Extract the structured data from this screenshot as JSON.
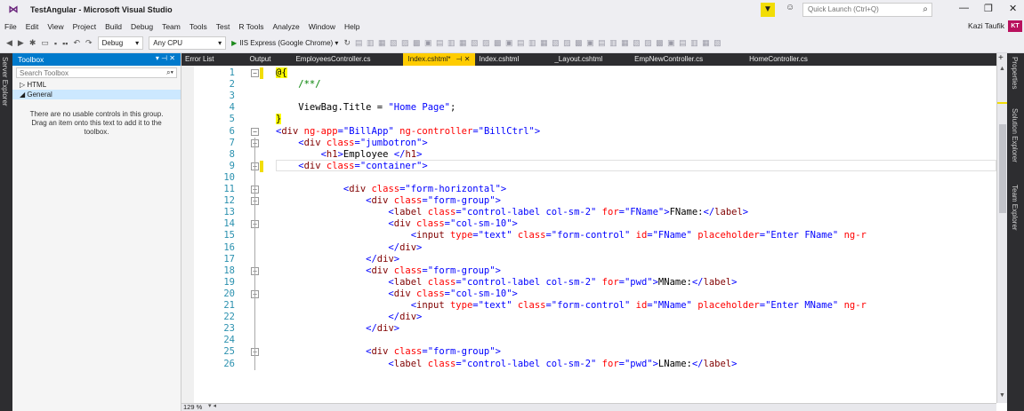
{
  "window": {
    "title": "TestAngular - Microsoft Visual Studio",
    "logo": "vs-logo",
    "quick_launch_placeholder": "Quick Launch (Ctrl+Q)"
  },
  "menu": [
    "File",
    "Edit",
    "View",
    "Project",
    "Build",
    "Debug",
    "Team",
    "Tools",
    "Test",
    "R Tools",
    "Analyze",
    "Window",
    "Help"
  ],
  "user": {
    "name": "Kazi Taufik",
    "initials": "KT",
    "badge_color": "#b9115e"
  },
  "toolbar": {
    "config": "Debug",
    "platform": "Any CPU",
    "run_target": "IIS Express (Google Chrome)"
  },
  "left_strip": {
    "label": "Server Explorer"
  },
  "toolbox": {
    "title": "Toolbox",
    "search_placeholder": "Search Toolbox",
    "groups": [
      {
        "label": "HTML",
        "expanded": false
      },
      {
        "label": "General",
        "expanded": true
      }
    ],
    "empty_message": "There are no usable controls in this group. Drag an item onto this text to add it to the toolbox."
  },
  "tabs": [
    {
      "label": "Error List"
    },
    {
      "label": "Output"
    },
    {
      "label": "EmployeesController.cs"
    },
    {
      "label": "Index.cshtml*",
      "active": true
    },
    {
      "label": "Index.cshtml"
    },
    {
      "label": "_Layout.cshtml"
    },
    {
      "label": "EmpNewController.cs"
    },
    {
      "label": "HomeController.cs"
    }
  ],
  "right_strip": [
    "Properties",
    "Solution Explorer",
    "Team Explorer"
  ],
  "editor": {
    "zoom": "129 %",
    "lines": [
      {
        "n": "1",
        "code": [
          {
            "t": "@{",
            "c": "razor"
          }
        ]
      },
      {
        "n": "2",
        "code": [
          {
            "t": "    /**/",
            "c": "cmt"
          }
        ]
      },
      {
        "n": "3",
        "code": []
      },
      {
        "n": "4",
        "code": [
          {
            "t": "    ViewBag.Title = ",
            "c": "txt"
          },
          {
            "t": "\"Home Page\"",
            "c": "str"
          },
          {
            "t": ";",
            "c": "txt"
          }
        ]
      },
      {
        "n": "5",
        "code": [
          {
            "t": "}",
            "c": "razor"
          }
        ]
      },
      {
        "n": "6",
        "code": [
          {
            "t": "<",
            "c": "punc"
          },
          {
            "t": "div",
            "c": "tag"
          },
          {
            "t": " ng-app",
            "c": "attr"
          },
          {
            "t": "=",
            "c": "punc"
          },
          {
            "t": "\"BillApp\"",
            "c": "str"
          },
          {
            "t": " ng-controller",
            "c": "attr"
          },
          {
            "t": "=",
            "c": "punc"
          },
          {
            "t": "\"BillCtrl\"",
            "c": "str"
          },
          {
            "t": ">",
            "c": "punc"
          }
        ]
      },
      {
        "n": "7",
        "code": [
          {
            "t": "    <",
            "c": "punc"
          },
          {
            "t": "div",
            "c": "tag"
          },
          {
            "t": " class",
            "c": "attr"
          },
          {
            "t": "=",
            "c": "punc"
          },
          {
            "t": "\"jumbotron\"",
            "c": "str"
          },
          {
            "t": ">",
            "c": "punc"
          }
        ]
      },
      {
        "n": "8",
        "code": [
          {
            "t": "        <",
            "c": "punc"
          },
          {
            "t": "h1",
            "c": "tag"
          },
          {
            "t": ">",
            "c": "punc"
          },
          {
            "t": "Employee ",
            "c": "txt"
          },
          {
            "t": "</",
            "c": "punc"
          },
          {
            "t": "h1",
            "c": "tag"
          },
          {
            "t": ">",
            "c": "punc"
          }
        ]
      },
      {
        "n": "9",
        "code": [
          {
            "t": "    <",
            "c": "punc"
          },
          {
            "t": "div",
            "c": "tag"
          },
          {
            "t": " class",
            "c": "attr"
          },
          {
            "t": "=",
            "c": "punc"
          },
          {
            "t": "\"container\"",
            "c": "str"
          },
          {
            "t": ">",
            "c": "punc"
          }
        ]
      },
      {
        "n": "10",
        "code": []
      },
      {
        "n": "11",
        "code": [
          {
            "t": "            <",
            "c": "punc"
          },
          {
            "t": "div",
            "c": "tag"
          },
          {
            "t": " class",
            "c": "attr"
          },
          {
            "t": "=",
            "c": "punc"
          },
          {
            "t": "\"form-horizontal\"",
            "c": "str"
          },
          {
            "t": ">",
            "c": "punc"
          }
        ]
      },
      {
        "n": "12",
        "code": [
          {
            "t": "                <",
            "c": "punc"
          },
          {
            "t": "div",
            "c": "tag"
          },
          {
            "t": " class",
            "c": "attr"
          },
          {
            "t": "=",
            "c": "punc"
          },
          {
            "t": "\"form-group\"",
            "c": "str"
          },
          {
            "t": ">",
            "c": "punc"
          }
        ]
      },
      {
        "n": "13",
        "code": [
          {
            "t": "                    <",
            "c": "punc"
          },
          {
            "t": "label",
            "c": "tag"
          },
          {
            "t": " class",
            "c": "attr"
          },
          {
            "t": "=",
            "c": "punc"
          },
          {
            "t": "\"control-label col-sm-2\"",
            "c": "str"
          },
          {
            "t": " for",
            "c": "attr"
          },
          {
            "t": "=",
            "c": "punc"
          },
          {
            "t": "\"FName\"",
            "c": "str"
          },
          {
            "t": ">",
            "c": "punc"
          },
          {
            "t": "FName:",
            "c": "txt"
          },
          {
            "t": "</",
            "c": "punc"
          },
          {
            "t": "label",
            "c": "tag"
          },
          {
            "t": ">",
            "c": "punc"
          }
        ]
      },
      {
        "n": "14",
        "code": [
          {
            "t": "                    <",
            "c": "punc"
          },
          {
            "t": "div",
            "c": "tag"
          },
          {
            "t": " class",
            "c": "attr"
          },
          {
            "t": "=",
            "c": "punc"
          },
          {
            "t": "\"col-sm-10\"",
            "c": "str"
          },
          {
            "t": ">",
            "c": "punc"
          }
        ]
      },
      {
        "n": "15",
        "code": [
          {
            "t": "                        <",
            "c": "punc"
          },
          {
            "t": "input",
            "c": "tag"
          },
          {
            "t": " type",
            "c": "attr"
          },
          {
            "t": "=",
            "c": "punc"
          },
          {
            "t": "\"text\"",
            "c": "str"
          },
          {
            "t": " class",
            "c": "attr"
          },
          {
            "t": "=",
            "c": "punc"
          },
          {
            "t": "\"form-control\"",
            "c": "str"
          },
          {
            "t": " id",
            "c": "attr"
          },
          {
            "t": "=",
            "c": "punc"
          },
          {
            "t": "\"FName\"",
            "c": "str"
          },
          {
            "t": " placeholder",
            "c": "attr"
          },
          {
            "t": "=",
            "c": "punc"
          },
          {
            "t": "\"Enter FName\"",
            "c": "str"
          },
          {
            "t": " ng-r",
            "c": "attr"
          }
        ]
      },
      {
        "n": "16",
        "code": [
          {
            "t": "                    </",
            "c": "punc"
          },
          {
            "t": "div",
            "c": "tag"
          },
          {
            "t": ">",
            "c": "punc"
          }
        ]
      },
      {
        "n": "17",
        "code": [
          {
            "t": "                </",
            "c": "punc"
          },
          {
            "t": "div",
            "c": "tag"
          },
          {
            "t": ">",
            "c": "punc"
          }
        ]
      },
      {
        "n": "18",
        "code": [
          {
            "t": "                <",
            "c": "punc"
          },
          {
            "t": "div",
            "c": "tag"
          },
          {
            "t": " class",
            "c": "attr"
          },
          {
            "t": "=",
            "c": "punc"
          },
          {
            "t": "\"form-group\"",
            "c": "str"
          },
          {
            "t": ">",
            "c": "punc"
          }
        ]
      },
      {
        "n": "19",
        "code": [
          {
            "t": "                    <",
            "c": "punc"
          },
          {
            "t": "label",
            "c": "tag"
          },
          {
            "t": " class",
            "c": "attr"
          },
          {
            "t": "=",
            "c": "punc"
          },
          {
            "t": "\"control-label col-sm-2\"",
            "c": "str"
          },
          {
            "t": " for",
            "c": "attr"
          },
          {
            "t": "=",
            "c": "punc"
          },
          {
            "t": "\"pwd\"",
            "c": "str"
          },
          {
            "t": ">",
            "c": "punc"
          },
          {
            "t": "MName:",
            "c": "txt"
          },
          {
            "t": "</",
            "c": "punc"
          },
          {
            "t": "label",
            "c": "tag"
          },
          {
            "t": ">",
            "c": "punc"
          }
        ]
      },
      {
        "n": "20",
        "code": [
          {
            "t": "                    <",
            "c": "punc"
          },
          {
            "t": "div",
            "c": "tag"
          },
          {
            "t": " class",
            "c": "attr"
          },
          {
            "t": "=",
            "c": "punc"
          },
          {
            "t": "\"col-sm-10\"",
            "c": "str"
          },
          {
            "t": ">",
            "c": "punc"
          }
        ]
      },
      {
        "n": "21",
        "code": [
          {
            "t": "                        <",
            "c": "punc"
          },
          {
            "t": "input",
            "c": "tag"
          },
          {
            "t": " type",
            "c": "attr"
          },
          {
            "t": "=",
            "c": "punc"
          },
          {
            "t": "\"text\"",
            "c": "str"
          },
          {
            "t": " class",
            "c": "attr"
          },
          {
            "t": "=",
            "c": "punc"
          },
          {
            "t": "\"form-control\"",
            "c": "str"
          },
          {
            "t": " id",
            "c": "attr"
          },
          {
            "t": "=",
            "c": "punc"
          },
          {
            "t": "\"MName\"",
            "c": "str"
          },
          {
            "t": " placeholder",
            "c": "attr"
          },
          {
            "t": "=",
            "c": "punc"
          },
          {
            "t": "\"Enter MName\"",
            "c": "str"
          },
          {
            "t": " ng-r",
            "c": "attr"
          }
        ]
      },
      {
        "n": "22",
        "code": [
          {
            "t": "                    </",
            "c": "punc"
          },
          {
            "t": "div",
            "c": "tag"
          },
          {
            "t": ">",
            "c": "punc"
          }
        ]
      },
      {
        "n": "23",
        "code": [
          {
            "t": "                </",
            "c": "punc"
          },
          {
            "t": "div",
            "c": "tag"
          },
          {
            "t": ">",
            "c": "punc"
          }
        ]
      },
      {
        "n": "24",
        "code": []
      },
      {
        "n": "25",
        "code": [
          {
            "t": "                <",
            "c": "punc"
          },
          {
            "t": "div",
            "c": "tag"
          },
          {
            "t": " class",
            "c": "attr"
          },
          {
            "t": "=",
            "c": "punc"
          },
          {
            "t": "\"form-group\"",
            "c": "str"
          },
          {
            "t": ">",
            "c": "punc"
          }
        ]
      },
      {
        "n": "26",
        "code": [
          {
            "t": "                    <",
            "c": "punc"
          },
          {
            "t": "label",
            "c": "tag"
          },
          {
            "t": " class",
            "c": "attr"
          },
          {
            "t": "=",
            "c": "punc"
          },
          {
            "t": "\"control-label col-sm-2\"",
            "c": "str"
          },
          {
            "t": " for",
            "c": "attr"
          },
          {
            "t": "=",
            "c": "punc"
          },
          {
            "t": "\"pwd\"",
            "c": "str"
          },
          {
            "t": ">",
            "c": "punc"
          },
          {
            "t": "LName:",
            "c": "txt"
          },
          {
            "t": "</",
            "c": "punc"
          },
          {
            "t": "label",
            "c": "tag"
          },
          {
            "t": ">",
            "c": "punc"
          }
        ]
      }
    ],
    "fold_lines": [
      "1",
      "6",
      "7",
      "9",
      "11",
      "12",
      "14",
      "18",
      "20",
      "25"
    ]
  }
}
